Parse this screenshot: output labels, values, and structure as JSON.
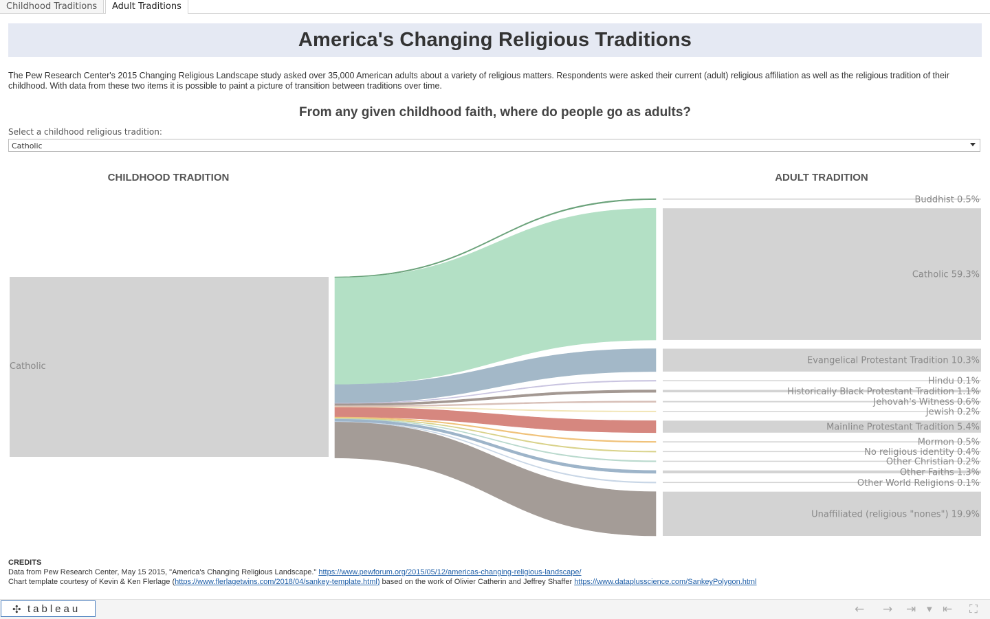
{
  "tabs": [
    "Childhood Traditions",
    "Adult Traditions"
  ],
  "title": "America's Changing Religious Traditions",
  "intro": "The Pew Research Center's 2015 Changing Religious Landscape study asked over 35,000 American adults about a variety of religious matters. Respondents were asked their current (adult) religious affiliation as well as the religious tradition of their childhood. With data from these two items it is possible to paint a picture of transition between traditions over time.",
  "subtitle": "From any given childhood faith, where do people go as adults?",
  "selector": {
    "label": "Select a childhood religious tradition:",
    "value": "Catholic"
  },
  "chart_data": {
    "type": "sankey",
    "left_header": "CHILDHOOD TRADITION",
    "right_header": "ADULT TRADITION",
    "source": "Catholic",
    "flows": [
      {
        "target": "Buddhist",
        "value": 0.5,
        "label": "Buddhist 0.5%",
        "color": "#6aa27a"
      },
      {
        "target": "Catholic",
        "value": 59.3,
        "label": "Catholic 59.3%",
        "color": "#b3e0c5"
      },
      {
        "target": "Evangelical Protestant Tradition",
        "value": 10.3,
        "label": "Evangelical Protestant Tradition 10.3%",
        "color": "#a3b8c8"
      },
      {
        "target": "Hindu",
        "value": 0.1,
        "label": "Hindu 0.1%",
        "color": "#c9c4e0"
      },
      {
        "target": "Historically Black Protestant Tradition",
        "value": 1.1,
        "label": "Historically Black Protestant Tradition 1.1%",
        "color": "#a39892"
      },
      {
        "target": "Jehovah's Witness",
        "value": 0.6,
        "label": "Jehovah's Witness 0.6%",
        "color": "#d7bfb7"
      },
      {
        "target": "Jewish",
        "value": 0.2,
        "label": "Jewish 0.2%",
        "color": "#f2e6b8"
      },
      {
        "target": "Mainline Protestant Tradition",
        "value": 5.4,
        "label": "Mainline Protestant Tradition 5.4%",
        "color": "#d6877f"
      },
      {
        "target": "Mormon",
        "value": 0.5,
        "label": "Mormon 0.5%",
        "color": "#f0c27a"
      },
      {
        "target": "No religious identity",
        "value": 0.4,
        "label": "No religious identity 0.4%",
        "color": "#d9d28a"
      },
      {
        "target": "Other Christian",
        "value": 0.2,
        "label": "Other Christian 0.2%",
        "color": "#b9d9cd"
      },
      {
        "target": "Other Faiths",
        "value": 1.3,
        "label": "Other Faiths 1.3%",
        "color": "#9db4c9"
      },
      {
        "target": "Other World Religions",
        "value": 0.1,
        "label": "Other World Religions 0.1%",
        "color": "#c8d6e6"
      },
      {
        "target": "Unaffiliated (religious \"nones\")",
        "value": 19.9,
        "label": "Unaffiliated (religious \"nones\") 19.9%",
        "color": "#a49c97"
      }
    ]
  },
  "credits": {
    "header": "CREDITS",
    "line1_text": "Data from Pew Research Center, May 15 2015, \"America's Changing Religious Landscape.\" ",
    "line1_link": "https://www.pewforum.org/2015/05/12/americas-changing-religious-landscape/",
    "line2_text_a": "Chart template courtesy of Kevin & Ken Flerlage (",
    "line2_link_a": "https://www.flerlagetwins.com/2018/04/sankey-template.html)",
    "line2_text_b": " based on the work of Olivier Catherin and Jeffrey Shaffer ",
    "line2_link_b": "https://www.dataplusscience.com/SankeyPolygon.html"
  },
  "footer": {
    "logo": "+ a b l e a u",
    "icons": [
      "undo-icon",
      "redo-icon",
      "revert-icon",
      "share-dropdown-icon",
      "reset-icon",
      "fullscreen-icon"
    ]
  }
}
